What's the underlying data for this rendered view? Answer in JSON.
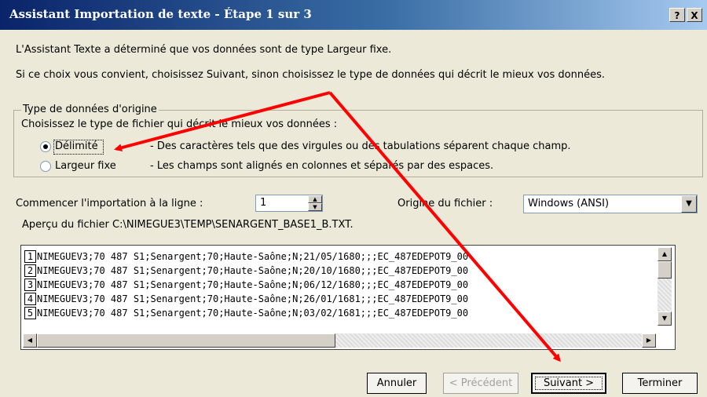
{
  "window": {
    "title": "Assistant Importation de texte - Étape 1 sur 3",
    "help_label": "?",
    "close_label": "X"
  },
  "intro": {
    "line1": "L'Assistant Texte a déterminé que vos données sont de type Largeur fixe.",
    "line2": "Si ce choix vous convient, choisissez Suivant, sinon choisissez le type de données qui décrit le mieux vos données."
  },
  "type_group": {
    "title": "Type de données d'origine",
    "prompt": "Choisissez le type de fichier qui décrit le mieux vos données :",
    "options": [
      {
        "label": "Délimité",
        "desc": "- Des caractères tels que des virgules ou des tabulations séparent chaque champ.",
        "checked": true
      },
      {
        "label": "Largeur fixe",
        "desc": "- Les champs sont alignés en colonnes et séparés par des espaces.",
        "checked": false
      }
    ]
  },
  "start_row": {
    "label": "Commencer l'importation à la ligne :",
    "value": "1"
  },
  "origin": {
    "label": "Origine du fichier :",
    "value": "Windows (ANSI)"
  },
  "preview": {
    "label": "Aperçu du fichier C:\\NIMEGUE3\\TEMP\\SENARGENT_BASE1_B.TXT.",
    "rows": [
      {
        "num": "1",
        "text": "NIMEGUEV3;70 487 S1;Senargent;70;Haute-Saône;N;21/05/1680;;;EC_487EDEPOT9_00"
      },
      {
        "num": "2",
        "text": "NIMEGUEV3;70 487 S1;Senargent;70;Haute-Saône;N;20/10/1680;;;EC_487EDEPOT9_00"
      },
      {
        "num": "3",
        "text": "NIMEGUEV3;70 487 S1;Senargent;70;Haute-Saône;N;06/12/1680;;;EC_487EDEPOT9_00"
      },
      {
        "num": "4",
        "text": "NIMEGUEV3;70 487 S1;Senargent;70;Haute-Saône;N;26/01/1681;;;EC_487EDEPOT9_00"
      },
      {
        "num": "5",
        "text": "NIMEGUEV3;70 487 S1;Senargent;70;Haute-Saône;N;03/02/1681;;;EC_487EDEPOT9_00"
      }
    ]
  },
  "buttons": {
    "cancel": "Annuler",
    "previous": "< Précédent",
    "next": "Suivant >",
    "finish": "Terminer"
  },
  "annotation": {
    "arrow_color": "#ff0000"
  }
}
